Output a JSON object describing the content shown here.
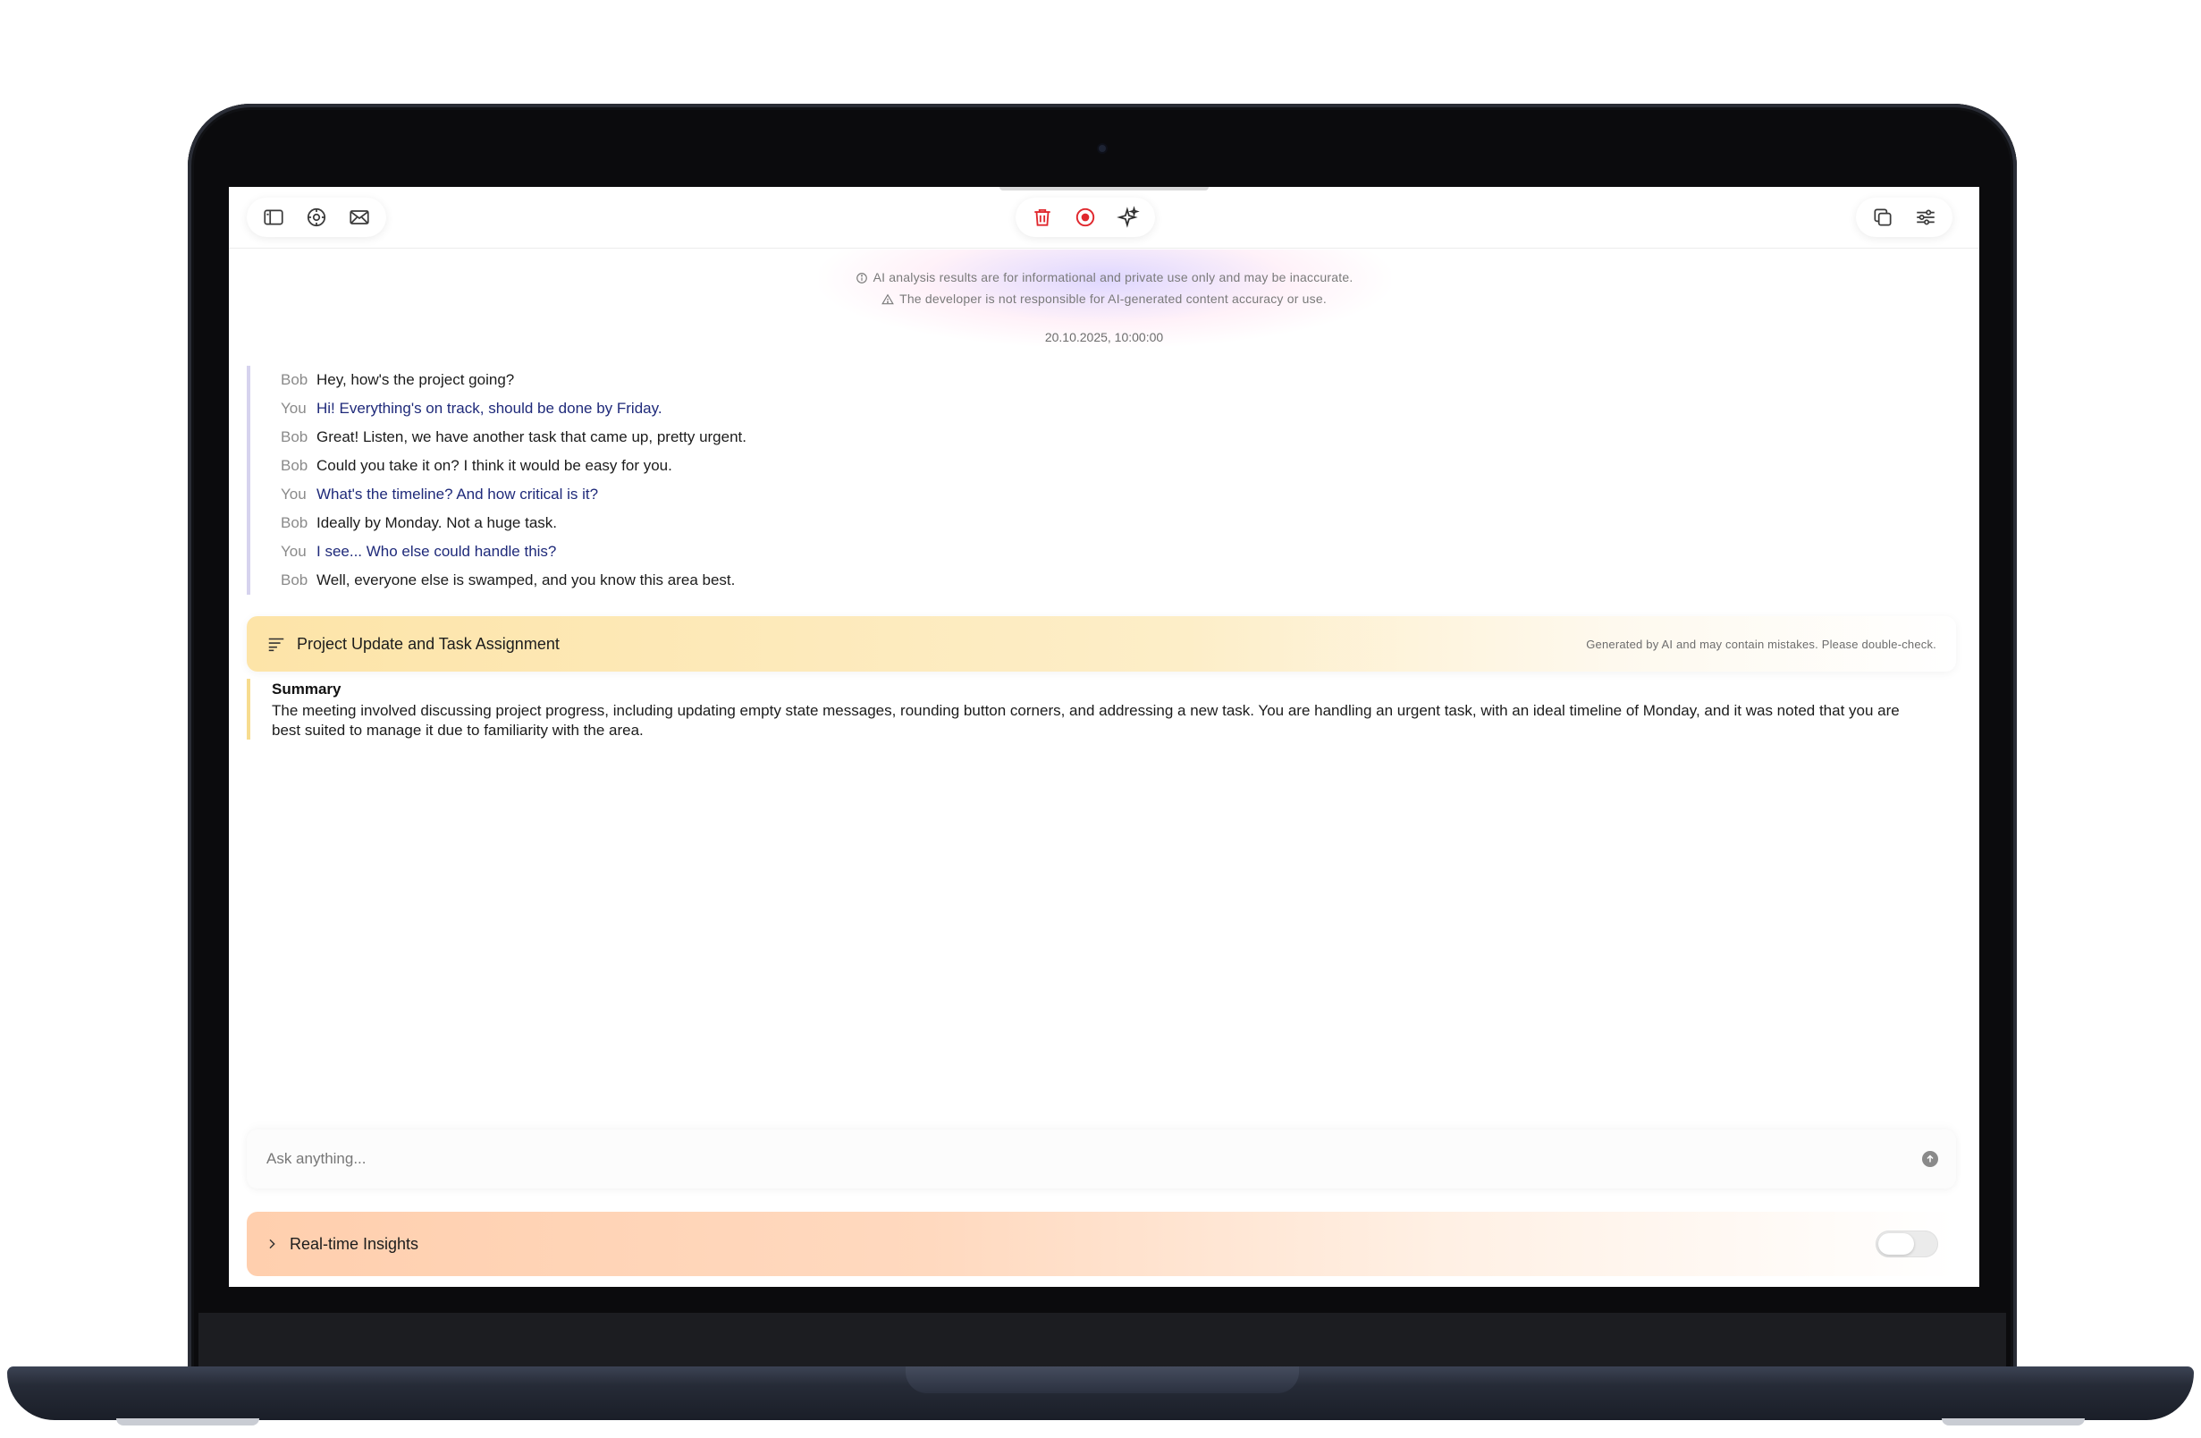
{
  "toolbar": {
    "left_icons": [
      "sidebar-icon",
      "settings-icon",
      "mail-icon"
    ],
    "center_icons": [
      "trash-icon",
      "record-icon",
      "sparkle-icon"
    ],
    "right_icons": [
      "copy-icon",
      "sliders-icon"
    ],
    "colors": {
      "danger": "#e0282e"
    }
  },
  "disclaimer": {
    "line1": "AI analysis results are for informational and private use only and may be inaccurate.",
    "line2": "The developer is not responsible for AI-generated content accuracy or use."
  },
  "timestamp": "20.10.2025, 10:00:00",
  "transcript": [
    {
      "speaker": "Bob",
      "text": "Hey, how's the project going?"
    },
    {
      "speaker": "You",
      "text": "Hi! Everything's on track, should be done by Friday."
    },
    {
      "speaker": "Bob",
      "text": "Great! Listen, we have another task that came up, pretty urgent."
    },
    {
      "speaker": "Bob",
      "text": "Could you take it on? I think it would be easy for you."
    },
    {
      "speaker": "You",
      "text": "What's the timeline? And how critical is it?"
    },
    {
      "speaker": "Bob",
      "text": "Ideally by Monday. Not a huge task."
    },
    {
      "speaker": "You",
      "text": "I see... Who else could handle this?"
    },
    {
      "speaker": "Bob",
      "text": "Well, everyone else is swamped, and you know this area best."
    }
  ],
  "summary": {
    "title": "Project Update and Task Assignment",
    "ai_note": "Generated by AI and may contain mistakes. Please double-check.",
    "label": "Summary",
    "text": "The meeting involved discussing project progress, including updating empty state messages, rounding button corners, and addressing a new task. You are handling an urgent task, with an ideal timeline of Monday, and it was noted that you are best suited to manage it due to familiarity with the area."
  },
  "ask": {
    "placeholder": "Ask anything..."
  },
  "insights": {
    "label": "Real-time Insights",
    "enabled": false
  }
}
